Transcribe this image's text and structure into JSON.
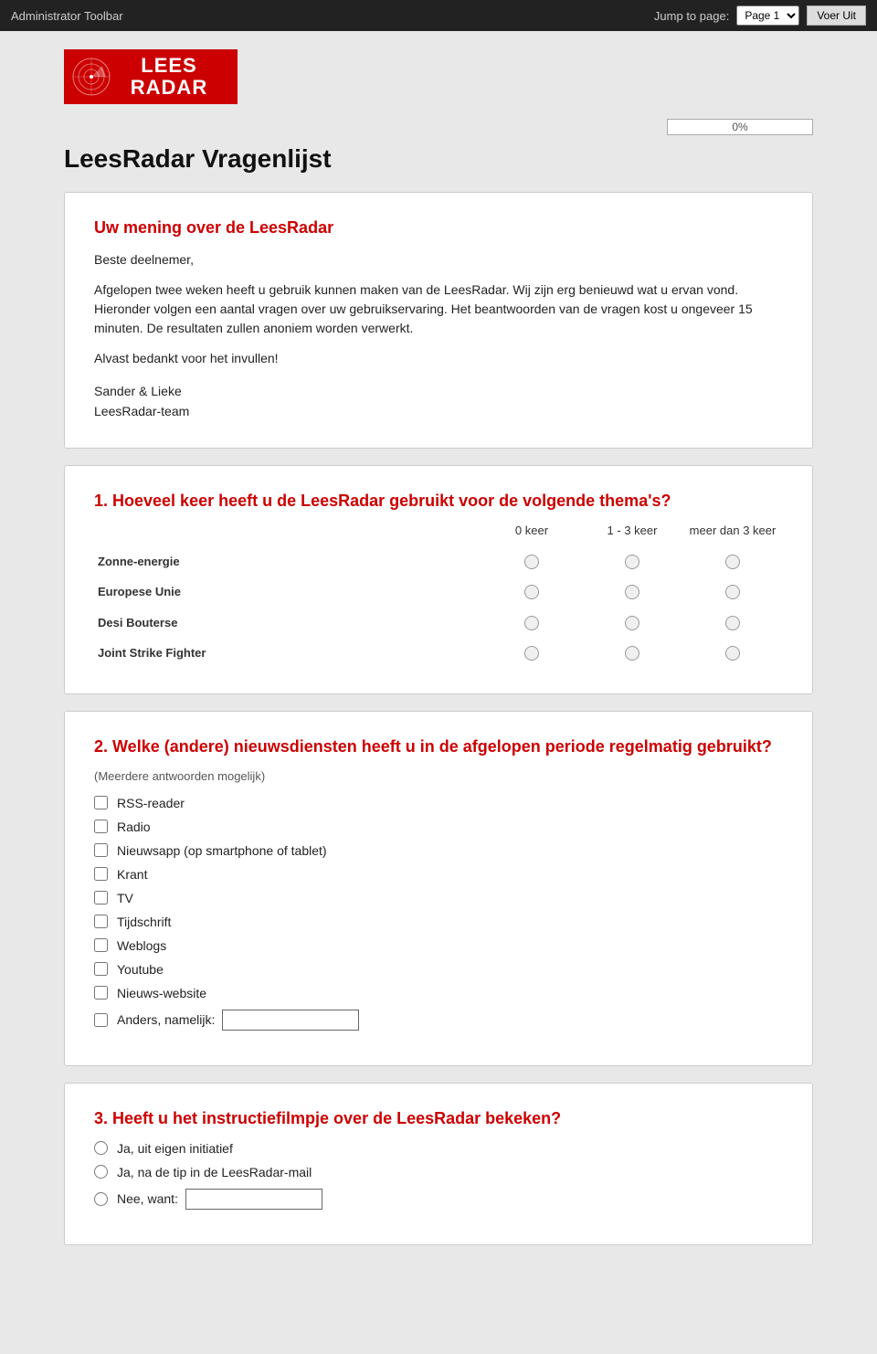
{
  "toolbar": {
    "label": "Administrator Toolbar",
    "jump_label": "Jump to page:",
    "page_select": "Page 1",
    "submit_button": "Voer Uit"
  },
  "progress": {
    "value": "0%",
    "percent": 0
  },
  "page": {
    "title": "LeesRadar Vragenlijst"
  },
  "logo": {
    "line1": "LEES",
    "line2": "RADAR"
  },
  "intro_card": {
    "title": "Uw mening over de LeesRadar",
    "greeting": "Beste deelnemer,",
    "body1": "Afgelopen twee weken heeft u gebruik kunnen maken van de LeesRadar. Wij zijn erg benieuwd wat u ervan vond. Hieronder volgen een aantal vragen over uw gebruikservaring. Het beantwoorden van de vragen kost u ongeveer 15 minuten. De resultaten zullen anoniem worden verwerkt.",
    "body2": "Alvast bedankt voor het invullen!",
    "signature_name": "Sander & Lieke",
    "signature_team": "LeesRadar-team"
  },
  "question1": {
    "title": "1. Hoeveel keer heeft u de LeesRadar gebruikt voor de volgende thema's?",
    "col1": "0 keer",
    "col2": "1 - 3 keer",
    "col3": "meer dan 3 keer",
    "rows": [
      {
        "label": "Zonne-energie"
      },
      {
        "label": "Europese Unie"
      },
      {
        "label": "Desi Bouterse"
      },
      {
        "label": "Joint Strike Fighter"
      }
    ]
  },
  "question2": {
    "title": "2. Welke (andere) nieuwsdiensten heeft u in de afgelopen periode regelmatig gebruikt?",
    "subtitle": "(Meerdere antwoorden mogelijk)",
    "options": [
      {
        "label": "RSS-reader"
      },
      {
        "label": "Radio"
      },
      {
        "label": "Nieuwsapp (op smartphone of tablet)"
      },
      {
        "label": "Krant"
      },
      {
        "label": "TV"
      },
      {
        "label": "Tijdschrift"
      },
      {
        "label": "Weblogs"
      },
      {
        "label": "Youtube"
      },
      {
        "label": "Nieuws-website"
      },
      {
        "label": "Anders, namelijk:",
        "has_text": true
      }
    ]
  },
  "question3": {
    "title": "3. Heeft u het instructiefilmpje over de LeesRadar bekeken?",
    "options": [
      {
        "label": "Ja, uit eigen initiatief"
      },
      {
        "label": "Ja, na de tip in de LeesRadar-mail"
      },
      {
        "label": "Nee, want:",
        "has_text": true
      }
    ]
  }
}
